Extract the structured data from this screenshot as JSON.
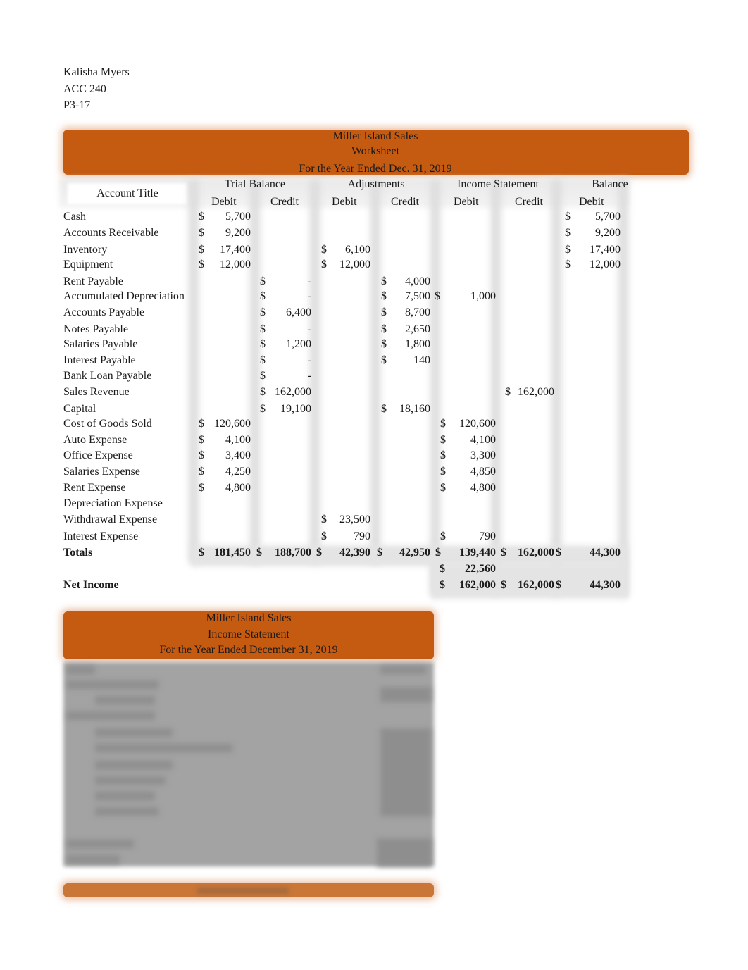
{
  "header": {
    "student_name": "Kalisha Myers",
    "course": "ACC 240",
    "problem": "P3-17"
  },
  "worksheet": {
    "company": "Miller Island Sales",
    "title": "Worksheet",
    "period": "For the Year Ended Dec. 31, 2019",
    "account_title_header": "Account Title",
    "groups": [
      "Trial Balance",
      "Adjustments",
      "Income Statement",
      "Balance"
    ],
    "subheaders": [
      "Debit",
      "Credit",
      "Debit",
      "Credit",
      "Debit",
      "Credit",
      "Debit"
    ],
    "rows": [
      {
        "account": "Cash",
        "tb_debit": "5,700",
        "tb_credit": "",
        "adj_debit": "",
        "adj_credit": "",
        "is_debit": "",
        "is_credit": "",
        "bal_debit": "5,700"
      },
      {
        "account": "Accounts Receivable",
        "tb_debit": "9,200",
        "tb_credit": "",
        "adj_debit": "",
        "adj_credit": "",
        "is_debit": "",
        "is_credit": "",
        "bal_debit": "9,200"
      },
      {
        "account": "Inventory",
        "tb_debit": "17,400",
        "tb_credit": "",
        "adj_debit": "6,100",
        "adj_credit": "",
        "is_debit": "",
        "is_credit": "",
        "bal_debit": "17,400"
      },
      {
        "account": "Equipment",
        "tb_debit": "12,000",
        "tb_credit": "",
        "adj_debit": "12,000",
        "adj_credit": "",
        "is_debit": "",
        "is_credit": "",
        "bal_debit": "12,000"
      },
      {
        "account": "Rent Payable",
        "tb_debit": "",
        "tb_credit": "-",
        "adj_debit": "",
        "adj_credit": "4,000",
        "is_debit": "",
        "is_credit": "",
        "bal_debit": ""
      },
      {
        "account": "Accumulated Depreciation",
        "tb_debit": "",
        "tb_credit": "-",
        "adj_debit": "",
        "adj_credit": "7,500",
        "is_debit": "1,000",
        "is_credit": "",
        "bal_debit": ""
      },
      {
        "account": "Accounts Payable",
        "tb_debit": "",
        "tb_credit": "6,400",
        "adj_debit": "",
        "adj_credit": "8,700",
        "is_debit": "",
        "is_credit": "",
        "bal_debit": ""
      },
      {
        "account": "Notes Payable",
        "tb_debit": "",
        "tb_credit": "-",
        "adj_debit": "",
        "adj_credit": "2,650",
        "is_debit": "",
        "is_credit": "",
        "bal_debit": ""
      },
      {
        "account": "Salaries Payable",
        "tb_debit": "",
        "tb_credit": "1,200",
        "adj_debit": "",
        "adj_credit": "1,800",
        "is_debit": "",
        "is_credit": "",
        "bal_debit": ""
      },
      {
        "account": "Interest Payable",
        "tb_debit": "",
        "tb_credit": "-",
        "adj_debit": "",
        "adj_credit": "140",
        "is_debit": "",
        "is_credit": "",
        "bal_debit": ""
      },
      {
        "account": "Bank Loan Payable",
        "tb_debit": "",
        "tb_credit": "-",
        "adj_debit": "",
        "adj_credit": "",
        "is_debit": "",
        "is_credit": "",
        "bal_debit": ""
      },
      {
        "account": "Sales Revenue",
        "tb_debit": "",
        "tb_credit": "162,000",
        "adj_debit": "",
        "adj_credit": "",
        "is_debit": "",
        "is_credit": "162,000",
        "bal_debit": ""
      },
      {
        "account": "Capital",
        "tb_debit": "",
        "tb_credit": "19,100",
        "adj_debit": "",
        "adj_credit": "18,160",
        "is_debit": "",
        "is_credit": "",
        "bal_debit": ""
      },
      {
        "account": "Cost of Goods Sold",
        "tb_debit": "120,600",
        "tb_credit": "",
        "adj_debit": "",
        "adj_credit": "",
        "is_debit": "120,600",
        "is_credit": "",
        "bal_debit": ""
      },
      {
        "account": "Auto Expense",
        "tb_debit": "4,100",
        "tb_credit": "",
        "adj_debit": "",
        "adj_credit": "",
        "is_debit": "4,100",
        "is_credit": "",
        "bal_debit": ""
      },
      {
        "account": "Office Expense",
        "tb_debit": "3,400",
        "tb_credit": "",
        "adj_debit": "",
        "adj_credit": "",
        "is_debit": "3,300",
        "is_credit": "",
        "bal_debit": ""
      },
      {
        "account": "Salaries Expense",
        "tb_debit": "4,250",
        "tb_credit": "",
        "adj_debit": "",
        "adj_credit": "",
        "is_debit": "4,850",
        "is_credit": "",
        "bal_debit": ""
      },
      {
        "account": "Rent Expense",
        "tb_debit": "4,800",
        "tb_credit": "",
        "adj_debit": "",
        "adj_credit": "",
        "is_debit": "4,800",
        "is_credit": "",
        "bal_debit": ""
      },
      {
        "account": "Depreciation Expense",
        "tb_debit": "",
        "tb_credit": "",
        "adj_debit": "",
        "adj_credit": "",
        "is_debit": "",
        "is_credit": "",
        "bal_debit": ""
      },
      {
        "account": "Withdrawal Expense",
        "tb_debit": "",
        "tb_credit": "",
        "adj_debit": "23,500",
        "adj_credit": "",
        "is_debit": "",
        "is_credit": "",
        "bal_debit": ""
      },
      {
        "account": "Interest Expense",
        "tb_debit": "",
        "tb_credit": "",
        "adj_debit": "790",
        "adj_credit": "",
        "is_debit": "790",
        "is_credit": "",
        "bal_debit": ""
      }
    ],
    "totals": {
      "label": "Totals",
      "tb_debit": "181,450",
      "tb_credit": "188,700",
      "adj_debit": "42,390",
      "adj_credit": "42,950",
      "is_debit": "139,440",
      "is_credit": "162,000",
      "bal_debit": "44,300"
    },
    "difference": {
      "is_debit": "22,560"
    },
    "net_income": {
      "label": "Net Income",
      "is_debit": "162,000",
      "is_credit": "162,000",
      "bal_debit": "44,300"
    },
    "currency_symbol": "$"
  },
  "income_statement": {
    "company": "Miller Island Sales",
    "title": "Income Statement",
    "period": "For the Year Ended December 31, 2019"
  },
  "colors": {
    "accent": "#c55a11",
    "blur_gray": "#a3a3a3"
  }
}
